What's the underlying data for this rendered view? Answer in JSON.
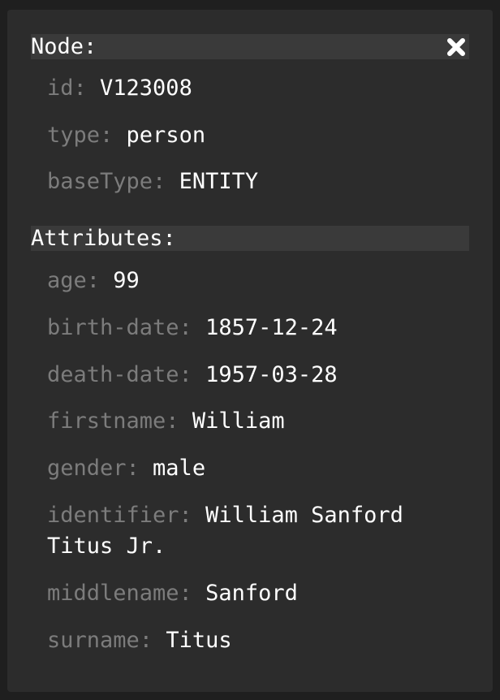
{
  "node": {
    "header": "Node:",
    "close_icon": "close-x-icon",
    "fields": [
      {
        "key": "id:",
        "value": "V123008"
      },
      {
        "key": "type:",
        "value": "person"
      },
      {
        "key": "baseType:",
        "value": "ENTITY"
      }
    ]
  },
  "attributes": {
    "header": "Attributes:",
    "fields": [
      {
        "key": "age:",
        "value": "99"
      },
      {
        "key": "birth-date:",
        "value": "1857-12-24"
      },
      {
        "key": "death-date:",
        "value": "1957-03-28"
      },
      {
        "key": "firstname:",
        "value": "William"
      },
      {
        "key": "gender:",
        "value": "male"
      },
      {
        "key": "identifier:",
        "value": "William Sanford Titus Jr."
      },
      {
        "key": "middlename:",
        "value": "Sanford"
      },
      {
        "key": "surname:",
        "value": "Titus"
      }
    ]
  },
  "colors": {
    "panel_bg": "#2c2c2c",
    "header_bg": "#3a3a3a",
    "key_text": "#7c7c7c",
    "value_text": "#ffffff"
  }
}
